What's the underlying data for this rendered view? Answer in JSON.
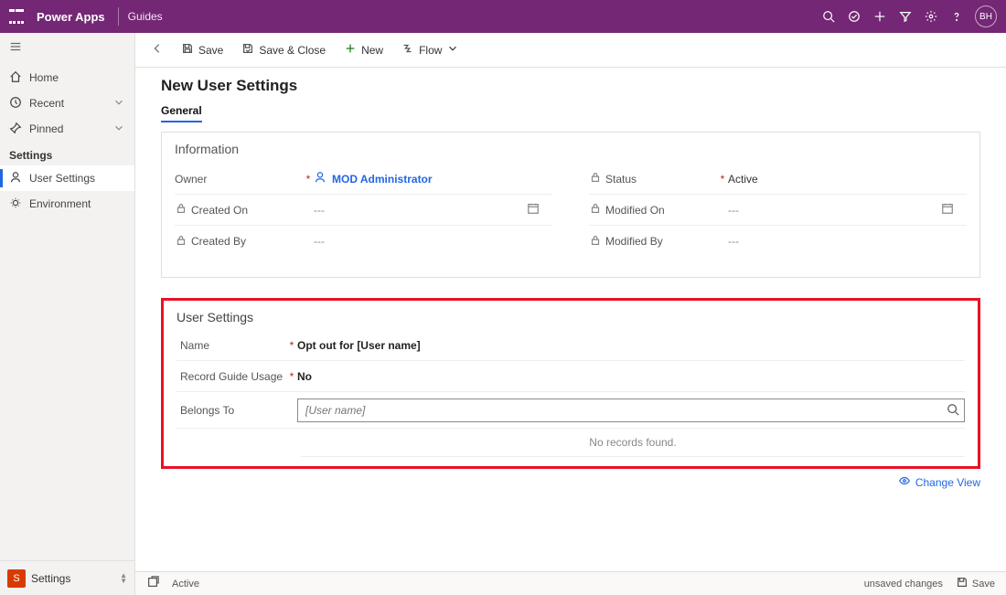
{
  "topbar": {
    "brand": "Power Apps",
    "app": "Guides",
    "avatar": "BH"
  },
  "sidebar": {
    "home": "Home",
    "recent": "Recent",
    "pinned": "Pinned",
    "group": "Settings",
    "user_settings": "User Settings",
    "environment": "Environment",
    "footer_badge": "S",
    "footer_label": "Settings"
  },
  "cmdbar": {
    "save": "Save",
    "save_close": "Save & Close",
    "new": "New",
    "flow": "Flow"
  },
  "page": {
    "title": "New User Settings",
    "tab": "General"
  },
  "info": {
    "section": "Information",
    "owner_lbl": "Owner",
    "owner_val": "MOD Administrator",
    "status_lbl": "Status",
    "status_val": "Active",
    "created_on_lbl": "Created On",
    "created_on_val": "---",
    "modified_on_lbl": "Modified On",
    "modified_on_val": "---",
    "created_by_lbl": "Created By",
    "created_by_val": "---",
    "modified_by_lbl": "Modified By",
    "modified_by_val": "---"
  },
  "us": {
    "section": "User Settings",
    "name_lbl": "Name",
    "name_val": "Opt out for [User name]",
    "rgu_lbl": "Record Guide Usage",
    "rgu_val": "No",
    "belongs_lbl": "Belongs To",
    "belongs_placeholder": "[User name]",
    "no_records": "No records found.",
    "change_view": "Change View"
  },
  "status": {
    "active": "Active",
    "unsaved": "unsaved changes",
    "save": "Save"
  }
}
